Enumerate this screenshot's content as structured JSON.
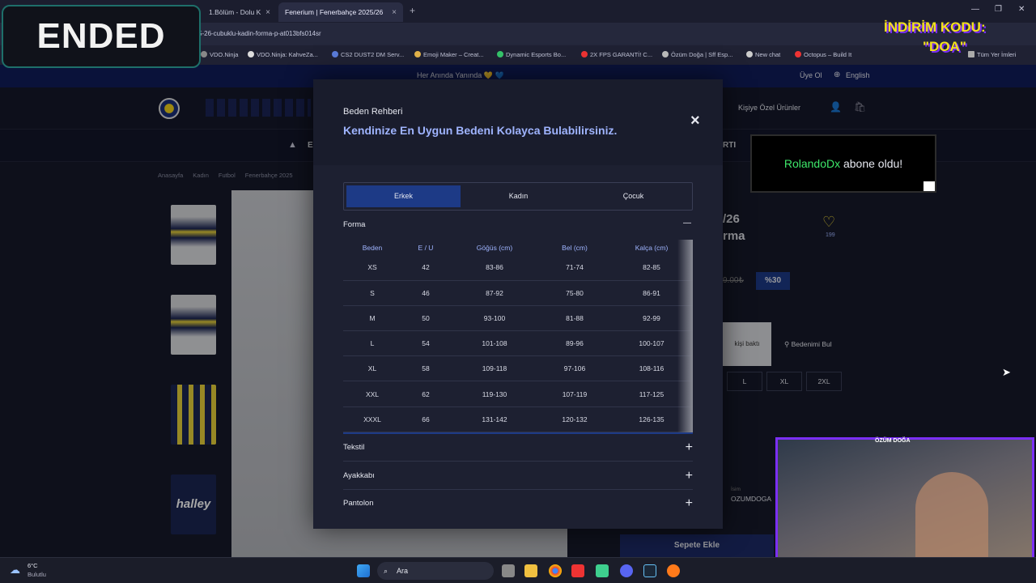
{
  "browser": {
    "tabs": [
      {
        "label": "1.Bölüm - Dolu K",
        "close": "×"
      },
      {
        "label": "Fenerium | Fenerbahçe 2025/26",
        "close": "×"
      }
    ],
    "new_tab": "+",
    "url": "5-26-cubuklu-kadin-forma-p-at013bfs014sr",
    "bookmarks": [
      "VDO.Ninja",
      "VDO.Ninja: KahveZa...",
      "CS2 DUST2 DM Serv...",
      "Emoji Maker – Creat...",
      "Dynamic Esports Bo...",
      "2X FPS GARANTİ! C...",
      "Özüm Doğa | Sff Esp...",
      "New chat",
      "Octopus – Build It",
      "Tüm Yer İmleri"
    ]
  },
  "stream": {
    "ended_label": "ENDED",
    "promo_line1": "İNDİRİM KODU:",
    "promo_line2": "\"DOA\"",
    "notification_user": "RolandoDx",
    "notification_text": "abone oldu!",
    "cam_name": "ÖZÜM DOĞA"
  },
  "site": {
    "banner": "Her Anında Yanında 💛 💙",
    "login": "Üye Ol",
    "language": "English",
    "personal": "Kişiye Özel Ürünler",
    "nav_fragment_left": "E",
    "nav_fragment_right": "RTI",
    "breadcrumbs": [
      "Anasayfa",
      "Kadın",
      "Futbol",
      "Fenerbahçe 2025"
    ],
    "product_title_1": "/26",
    "product_title_2": "rma",
    "favorite_count": "199",
    "old_price": "9.00₺",
    "discount": "%30",
    "viewers_text": "kişi baktı",
    "find_size": "Bedenimi Bul",
    "sizes": [
      "L",
      "XL",
      "2XL"
    ],
    "name_label": "İsim",
    "name_value": "OZUMDOGA",
    "add_to_cart": "Sepete Ekle"
  },
  "modal": {
    "title": "Beden Rehberi",
    "subtitle": "Kendinize En Uygun Bedeni Kolayca Bulabilirsiniz.",
    "close_icon": "×",
    "gender_tabs": [
      "Erkek",
      "Kadın",
      "Çocuk"
    ],
    "selected_tab": "Erkek",
    "section_open": "Forma",
    "section_open_icon": "—",
    "table": {
      "headers": [
        "Beden",
        "E / U",
        "Göğüs (cm)",
        "Bel (cm)",
        "Kalça (cm)"
      ],
      "rows": [
        [
          "XS",
          "42",
          "83-86",
          "71-74",
          "82-85"
        ],
        [
          "S",
          "46",
          "87-92",
          "75-80",
          "86-91"
        ],
        [
          "M",
          "50",
          "93-100",
          "81-88",
          "92-99"
        ],
        [
          "L",
          "54",
          "101-108",
          "89-96",
          "100-107"
        ],
        [
          "XL",
          "58",
          "109-118",
          "97-106",
          "108-116"
        ],
        [
          "XXL",
          "62",
          "119-130",
          "107-119",
          "117-125"
        ],
        [
          "XXXL",
          "66",
          "131-142",
          "120-132",
          "126-135"
        ]
      ]
    },
    "sections_closed": [
      "Tekstil",
      "Ayakkabı",
      "Pantolon"
    ],
    "plus_icon": "+"
  },
  "taskbar": {
    "temp": "6°C",
    "weather": "Bulutlu",
    "search": "Ara"
  },
  "colors": {
    "accent": "#1d3a86",
    "brand_navy": "#101d5a",
    "header_blue": "#9fb4ff",
    "twitch_purple": "#7b2ff7"
  }
}
